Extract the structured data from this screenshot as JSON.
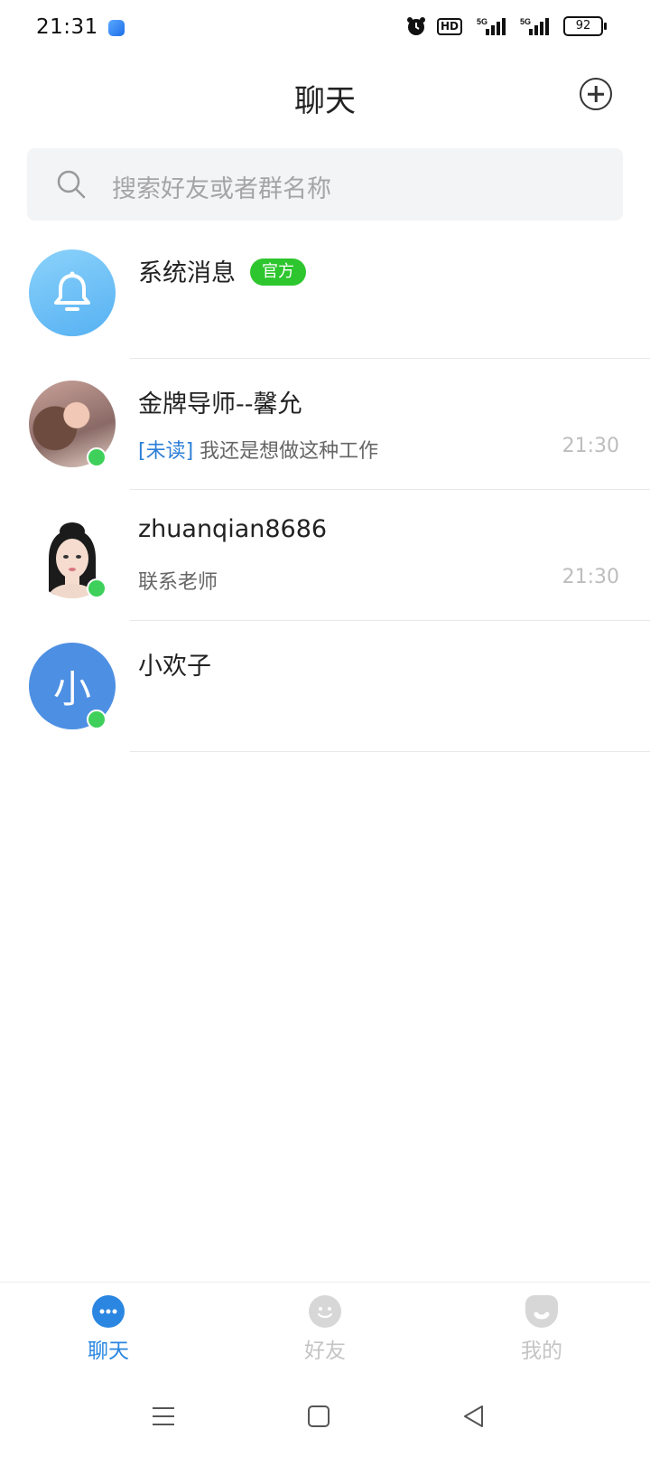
{
  "status_bar": {
    "time": "21:31",
    "hd": "HD",
    "net1": "5G",
    "net2": "5G",
    "battery": "92"
  },
  "header": {
    "title": "聊天",
    "add_icon": "plus-circle-icon"
  },
  "search": {
    "placeholder": "搜索好友或者群名称"
  },
  "chats": [
    {
      "name": "系统消息",
      "badge": "官方",
      "preview": "",
      "time": "",
      "avatar": "bell-icon",
      "online": false
    },
    {
      "name": "金牌导师--馨允",
      "unread_tag": "[未读]",
      "preview": "我还是想做这种工作",
      "time": "21:30",
      "avatar": "photo",
      "online": true
    },
    {
      "name": "zhuanqian8686",
      "preview": "联系老师",
      "time": "21:30",
      "avatar": "photo",
      "online": true
    },
    {
      "name": "小欢子",
      "avatar_letter": "小",
      "preview": "",
      "time": "",
      "online": true
    }
  ],
  "tabs": [
    {
      "label": "聊天",
      "icon": "chat-bubble-icon",
      "active": true
    },
    {
      "label": "好友",
      "icon": "smile-icon",
      "active": false
    },
    {
      "label": "我的",
      "icon": "profile-icon",
      "active": false
    }
  ],
  "colors": {
    "accent": "#2a86e0",
    "online": "#3ed05a",
    "official_badge": "#2ec62e",
    "unread_tag": "#2c7fd6"
  }
}
